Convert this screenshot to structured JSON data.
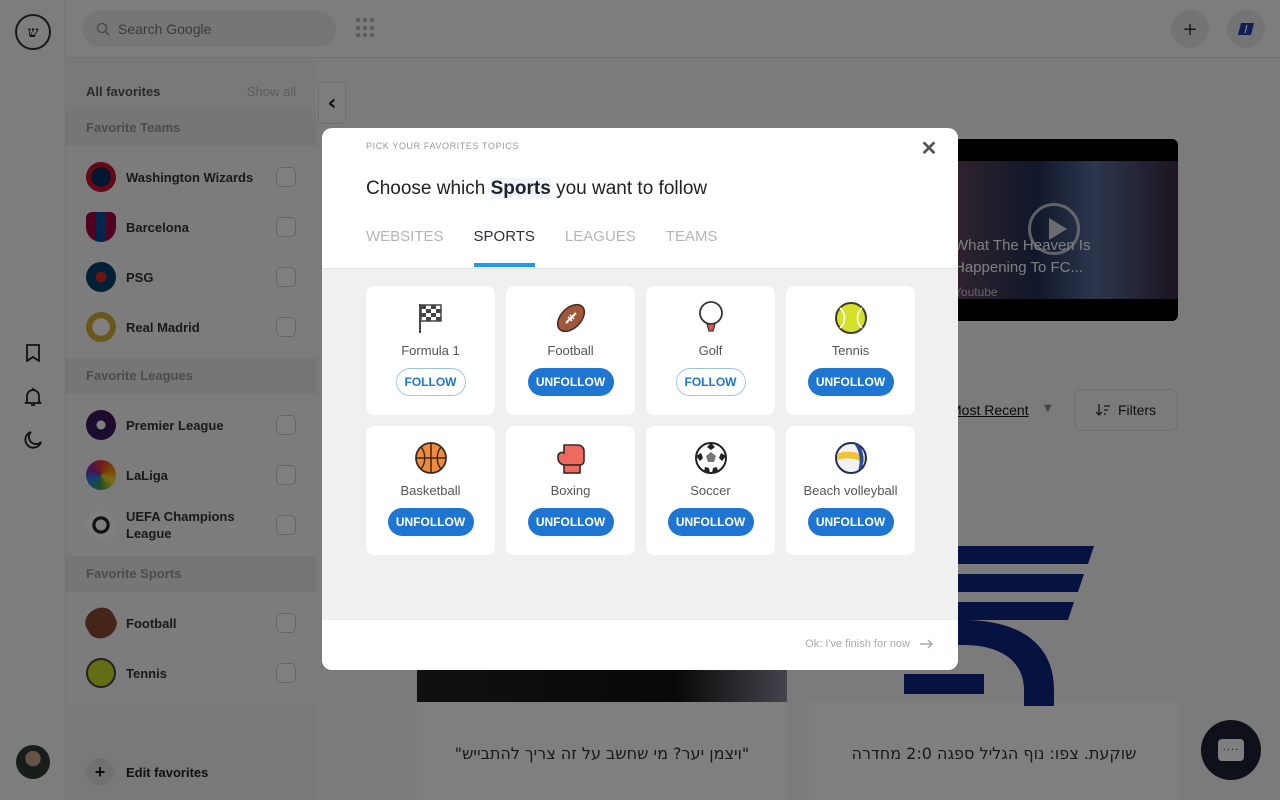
{
  "topbar": {
    "search_placeholder": "Search Google",
    "add_icon": "plus-icon",
    "extension_icon": "extension-badge-icon"
  },
  "rail": {
    "logo": "site-logo",
    "icons": [
      "bookmark-icon",
      "bell-icon",
      "moon-icon"
    ],
    "avatar": "user-avatar"
  },
  "favorites": {
    "title": "All favorites",
    "show_all": "Show all",
    "sections": [
      {
        "title": "Favorite Teams",
        "items": [
          {
            "name": "Washington Wizards",
            "color": "#c8102e"
          },
          {
            "name": "Barcelona",
            "color": "#a50044"
          },
          {
            "name": "PSG",
            "color": "#004170"
          },
          {
            "name": "Real Madrid",
            "color": "#d4af37"
          }
        ]
      },
      {
        "title": "Favorite Leagues",
        "items": [
          {
            "name": "Premier League",
            "color": "#3d185c"
          },
          {
            "name": "LaLiga",
            "color": "#ee8707"
          },
          {
            "name": "UEFA Champions League",
            "color": "#222222"
          }
        ]
      },
      {
        "title": "Favorite Sports",
        "items": [
          {
            "name": "Football",
            "color": "#8b4a35"
          },
          {
            "name": "Tennis",
            "color": "#c9d92b"
          }
        ]
      }
    ],
    "edit_label": "Edit favorites"
  },
  "main": {
    "video": {
      "title": "What The Heaven Is Happening To FC...",
      "source": "Youtube"
    },
    "sort_label": "Most Recent",
    "filters_label": "Filters",
    "news": [
      {
        "caption": "\"ויצמן יער? מי שחשב על זה צריך להתבייש\""
      },
      {
        "caption": "שוקעת. צפו: נוף הגליל ספגה 2:0 מחדרה"
      }
    ]
  },
  "modal": {
    "kicker": "PICK YOUR FAVORITES TOPICS",
    "title_pre": "Choose which ",
    "title_bold": "Sports",
    "title_post": " you want to follow",
    "tabs": [
      {
        "label": "WEBSITES",
        "active": false
      },
      {
        "label": "SPORTS",
        "active": true
      },
      {
        "label": "LEAGUES",
        "active": false
      },
      {
        "label": "TEAMS",
        "active": false
      }
    ],
    "sports": [
      {
        "name": "Formula 1",
        "icon": "checkered-flag-icon",
        "following": false,
        "button": "FOLLOW"
      },
      {
        "name": "Football",
        "icon": "american-football-icon",
        "following": true,
        "button": "UNFOLLOW"
      },
      {
        "name": "Golf",
        "icon": "golf-ball-icon",
        "following": false,
        "button": "FOLLOW"
      },
      {
        "name": "Tennis",
        "icon": "tennis-ball-icon",
        "following": true,
        "button": "UNFOLLOW"
      },
      {
        "name": "Basketball",
        "icon": "basketball-icon",
        "following": true,
        "button": "UNFOLLOW"
      },
      {
        "name": "Boxing",
        "icon": "boxing-glove-icon",
        "following": true,
        "button": "UNFOLLOW"
      },
      {
        "name": "Soccer",
        "icon": "soccer-ball-icon",
        "following": true,
        "button": "UNFOLLOW"
      },
      {
        "name": "Beach volleyball",
        "icon": "volleyball-icon",
        "following": true,
        "button": "UNFOLLOW"
      }
    ],
    "finish_label": "Ok: I've finish for now",
    "accent": "#1f76d2",
    "tab_underline": "#2196f3"
  },
  "chat": {
    "icon": "chat-bubble-icon"
  }
}
